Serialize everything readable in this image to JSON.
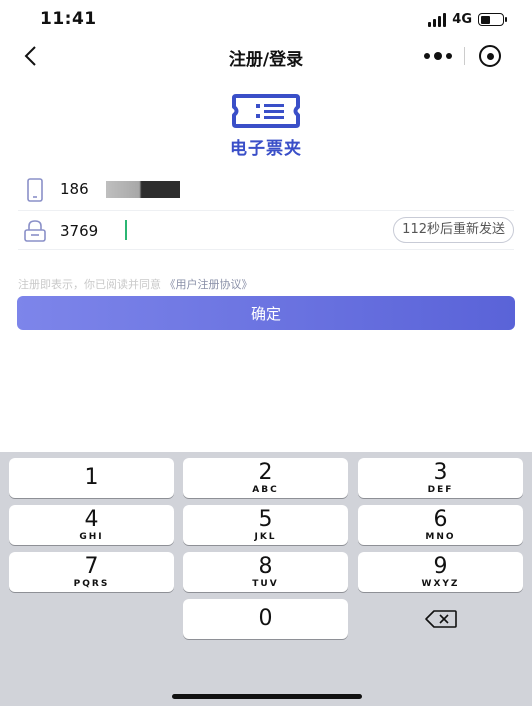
{
  "status_bar": {
    "time": "11:41",
    "network": "4G"
  },
  "nav": {
    "title": "注册/登录"
  },
  "logo": {
    "text": "电子票夹"
  },
  "form": {
    "phone_prefix": "186",
    "code_value": "3769",
    "resend_label": "112秒后重新发送"
  },
  "agreement": {
    "text": "注册即表示，你已阅读并同意",
    "link": "《用户注册协议》"
  },
  "confirm_label": "确定",
  "keyboard": {
    "keys": [
      {
        "digit": "1",
        "letters": ""
      },
      {
        "digit": "2",
        "letters": "ABC"
      },
      {
        "digit": "3",
        "letters": "DEF"
      },
      {
        "digit": "4",
        "letters": "GHI"
      },
      {
        "digit": "5",
        "letters": "JKL"
      },
      {
        "digit": "6",
        "letters": "MNO"
      },
      {
        "digit": "7",
        "letters": "PQRS"
      },
      {
        "digit": "8",
        "letters": "TUV"
      },
      {
        "digit": "9",
        "letters": "WXYZ"
      },
      {
        "digit": "0",
        "letters": ""
      }
    ]
  },
  "colors": {
    "brand": "#3a4fc8",
    "button_start": "#7d85ea",
    "button_end": "#5a63d8",
    "keyboard_bg": "#d1d3d9",
    "caret": "#2bb673"
  },
  "icons": {
    "back": "chevron-left-icon",
    "more": "more-dots-icon",
    "close": "close-miniprogram-icon",
    "phone": "phone-icon",
    "lock": "lock-icon",
    "delete": "backspace-icon"
  }
}
